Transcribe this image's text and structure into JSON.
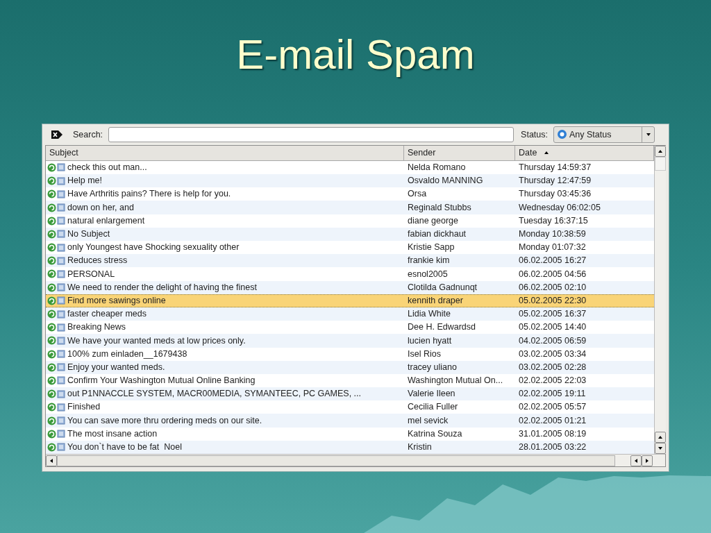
{
  "slide_title": "E-mail Spam",
  "toolbar": {
    "search_label": "Search:",
    "status_label": "Status:",
    "status_value": "Any Status"
  },
  "columns": [
    {
      "label": "Subject",
      "sorted": false
    },
    {
      "label": "Sender",
      "sorted": false
    },
    {
      "label": "Date",
      "sorted": true
    }
  ],
  "rows": [
    {
      "subject": "check this out man...",
      "sender": "Nelda Romano",
      "date": "Thursday 14:59:37",
      "selected": false
    },
    {
      "subject": "Help me!",
      "sender": "Osvaldo MANNING",
      "date": "Thursday 12:47:59",
      "selected": false
    },
    {
      "subject": "Have Arthritis pains? There is help for you.",
      "sender": "Orsa",
      "date": "Thursday 03:45:36",
      "selected": false
    },
    {
      "subject": "down on her, and",
      "sender": "Reginald Stubbs",
      "date": "Wednesday 06:02:05",
      "selected": false
    },
    {
      "subject": "natural enlargement",
      "sender": "diane george",
      "date": "Tuesday 16:37:15",
      "selected": false
    },
    {
      "subject": "No Subject",
      "sender": "fabian dickhaut",
      "date": "Monday 10:38:59",
      "selected": false
    },
    {
      "subject": "only Youngest have Shocking sexuality other",
      "sender": "Kristie Sapp",
      "date": "Monday 01:07:32",
      "selected": false
    },
    {
      "subject": "Reduces stress",
      "sender": "frankie kim",
      "date": "06.02.2005 16:27",
      "selected": false
    },
    {
      "subject": "PERSONAL",
      "sender": "esnol2005",
      "date": "06.02.2005 04:56",
      "selected": false
    },
    {
      "subject": "We need to render the delight of having the finest",
      "sender": "Clotilda Gadnunqt",
      "date": "06.02.2005 02:10",
      "selected": false
    },
    {
      "subject": "Find more sawings online",
      "sender": "kennith draper",
      "date": "05.02.2005 22:30",
      "selected": true
    },
    {
      "subject": "faster cheaper meds",
      "sender": "Lidia White",
      "date": "05.02.2005 16:37",
      "selected": false
    },
    {
      "subject": "Breaking News",
      "sender": "Dee H. Edwardsd",
      "date": "05.02.2005 14:40",
      "selected": false
    },
    {
      "subject": "We have your wanted meds at low prices only.",
      "sender": "lucien hyatt",
      "date": "04.02.2005 06:59",
      "selected": false
    },
    {
      "subject": "100% zum einladen__1679438",
      "sender": "Isel Rios",
      "date": "03.02.2005 03:34",
      "selected": false
    },
    {
      "subject": "Enjoy your wanted meds.",
      "sender": "tracey uliano",
      "date": "03.02.2005 02:28",
      "selected": false
    },
    {
      "subject": "Confirm Your Washington Mutual Online Banking",
      "sender": "Washington Mutual On...",
      "date": "02.02.2005 22:03",
      "selected": false
    },
    {
      "subject": "out P1NNACCLE SYSTEM, MACR00MEDIA, SYMANTEEC, PC GAMES, ...",
      "sender": "Valerie Ileen",
      "date": "02.02.2005 19:11",
      "selected": false
    },
    {
      "subject": "Finished",
      "sender": "Cecilia Fuller",
      "date": "02.02.2005 05:57",
      "selected": false
    },
    {
      "subject": "You can save more thru ordering meds on our site.",
      "sender": "mel sevick",
      "date": "02.02.2005 01:21",
      "selected": false
    },
    {
      "subject": "The most insane action",
      "sender": "Katrina Souza",
      "date": "31.01.2005 08:19",
      "selected": false
    },
    {
      "subject": "You don`t have to be fat  Noel",
      "sender": "Kristin",
      "date": "28.01.2005 03:22",
      "selected": false
    }
  ]
}
